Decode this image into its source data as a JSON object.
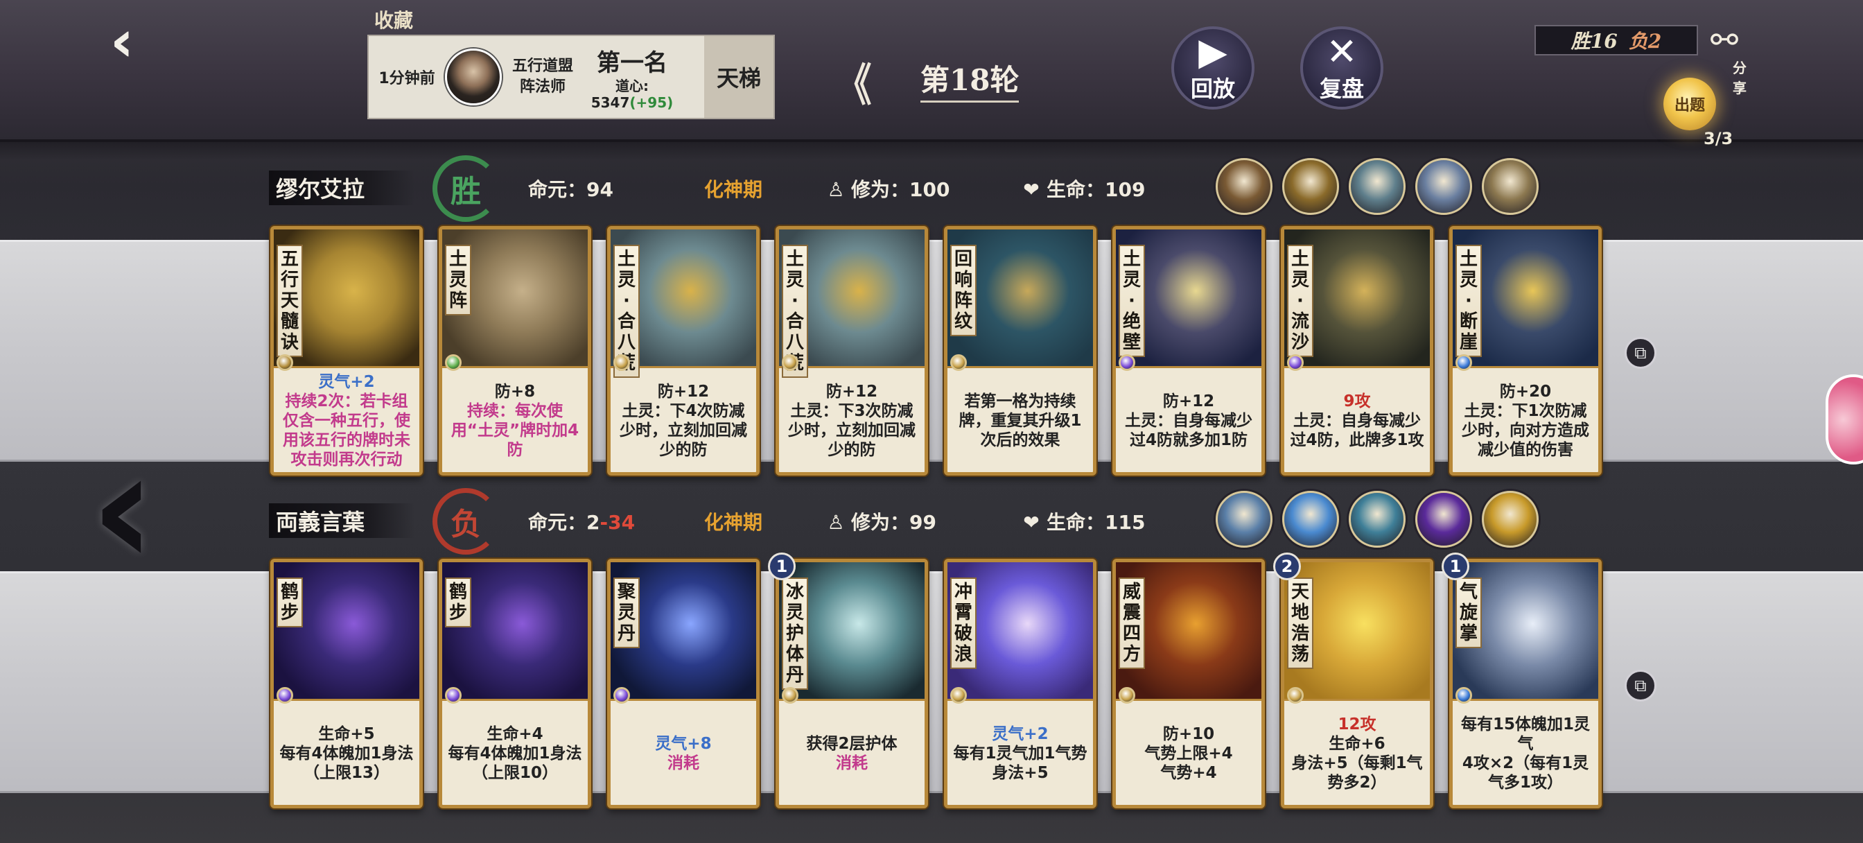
{
  "header": {
    "back_icon": "double-arrow-left-icon",
    "favorites_label": "收藏",
    "record": {
      "time": "1分钟前",
      "school_line1": "五行道盟",
      "school_line2": "阵法师",
      "rank": "第一名",
      "daoxin_label": "道心:",
      "daoxin_value": "5347",
      "daoxin_delta": "(+95)",
      "mode": "天梯"
    },
    "round": "第18轮",
    "play_label": "回放",
    "review_label": "复盘",
    "wins": "胜16",
    "losses": "负2",
    "share_label": "分享",
    "quiz_label": "出题",
    "quiz_count": "3/3"
  },
  "players": [
    {
      "name": "缪尔艾拉",
      "result": "胜",
      "life_essence_label": "命元：",
      "life_essence": "94",
      "life_essence_delta": "",
      "realm": "化神期",
      "cultivation_label": "修为：",
      "cultivation": "100",
      "hp_label": "生命：",
      "hp": "109",
      "badge_colors": [
        "#7a5a34",
        "#8a6a2a",
        "#5f7f8c",
        "#6a7fa0",
        "#8c7850"
      ],
      "cards": [
        {
          "name": "五行天髓诀",
          "text": [
            "灵气+2",
            "持续2次：若卡组仅含一种五行，使用该五行的牌时未攻击则再次行动"
          ],
          "art": [
            "#3a2b12",
            "#d8b34a",
            "#a78532"
          ],
          "gem": "#b38d3a",
          "level": ""
        },
        {
          "name": "土灵阵",
          "text": [
            "防+8",
            "持续：每次使用“土灵”牌时加4防"
          ],
          "art": [
            "#4c3f2a",
            "#c5b08a",
            "#8f7b58"
          ],
          "gem": "#5fae4a",
          "level": ""
        },
        {
          "name": "土灵·合八荒",
          "text": [
            "防+12",
            "土灵：下4次防减少时，立刻加回减少的防"
          ],
          "art": [
            "#3b4a50",
            "#d9b24a",
            "#6d8a90"
          ],
          "gem": "#c8a24a",
          "level": ""
        },
        {
          "name": "土灵·合八荒",
          "text": [
            "防+12",
            "土灵：下3次防减少时，立刻加回减少的防"
          ],
          "art": [
            "#3b4a50",
            "#d9b24a",
            "#6d8a90"
          ],
          "gem": "#c8a24a",
          "level": ""
        },
        {
          "name": "回响阵纹",
          "text": [
            "若第一格为持续牌，重复其升级1次后的效果"
          ],
          "art": [
            "#1f3a48",
            "#c7a85a",
            "#2d5565"
          ],
          "gem": "#c8a24a",
          "level": ""
        },
        {
          "name": "土灵·绝壁",
          "text": [
            "防+12",
            "土灵：自身每减少过4防就多加1防"
          ],
          "art": [
            "#1c2140",
            "#e8d890",
            "#4a4a6a"
          ],
          "gem": "#7a4ad8",
          "level": ""
        },
        {
          "name": "土灵·流沙",
          "text": [
            "9攻",
            "土灵：自身每减少过4防，此牌多1攻"
          ],
          "art": [
            "#23251e",
            "#d4b25a",
            "#55533a"
          ],
          "gem": "#7a4ad8",
          "level": ""
        },
        {
          "name": "土灵·断崖",
          "text": [
            "防+20",
            "土灵：下1次防减少时，向对方造成减少值的伤害"
          ],
          "art": [
            "#1b2a48",
            "#e8c658",
            "#3a4a6a"
          ],
          "gem": "#3a7ad8",
          "level": ""
        }
      ]
    },
    {
      "name": "両義言葉",
      "result": "负",
      "life_essence_label": "命元：",
      "life_essence": "2",
      "life_essence_delta": "-34",
      "realm": "化神期",
      "cultivation_label": "修为：",
      "cultivation": "99",
      "hp_label": "生命：",
      "hp": "115",
      "badge_colors": [
        "#5a7fa8",
        "#4a8ad0",
        "#3f7f98",
        "#5a2a9a",
        "#c89a2a"
      ],
      "cards": [
        {
          "name": "鹤步",
          "text": [
            "生命+5",
            "每有4体魄加1身法（上限13）"
          ],
          "art": [
            "#1b1240",
            "#8a5ad8",
            "#3a2a78"
          ],
          "gem": "#7a4ad8",
          "level": ""
        },
        {
          "name": "鹤步",
          "text": [
            "生命+4",
            "每有4体魄加1身法（上限10）"
          ],
          "art": [
            "#1b1240",
            "#8a5ad8",
            "#3a2a78"
          ],
          "gem": "#7a4ad8",
          "level": ""
        },
        {
          "name": "聚灵丹",
          "text": [
            "灵气+8",
            "消耗"
          ],
          "art": [
            "#101838",
            "#8aa6ff",
            "#2a3a88"
          ],
          "gem": "#7a4ad8",
          "level": ""
        },
        {
          "name": "冰灵护体丹",
          "text": [
            "获得2层护体",
            "消耗"
          ],
          "art": [
            "#1a2a30",
            "#c8e8e8",
            "#5a8a90"
          ],
          "gem": "#c8a24a",
          "level": "1"
        },
        {
          "name": "冲霄破浪",
          "text": [
            "灵气+2",
            "每有1灵气加1气势",
            "身法+5"
          ],
          "art": [
            "#3a2a78",
            "#e8d8f8",
            "#6a5ad8"
          ],
          "gem": "#c8a24a",
          "level": ""
        },
        {
          "name": "威震四方",
          "text": [
            "防+10",
            "气势上限+4",
            "气势+4"
          ],
          "art": [
            "#4a1a10",
            "#e8a030",
            "#8a3a18"
          ],
          "gem": "#c8a24a",
          "level": ""
        },
        {
          "name": "天地浩荡",
          "text": [
            "12攻",
            "生命+6",
            "身法+5（每剩1气势多2）"
          ],
          "art": [
            "#a87a20",
            "#f8e060",
            "#d8a838"
          ],
          "gem": "#c8a24a",
          "level": "2"
        },
        {
          "name": "气旋掌",
          "text": [
            "每有15体魄加1灵气",
            "4攻×2（每有1灵气多1攻）"
          ],
          "art": [
            "#2a3a58",
            "#e8eef8",
            "#7a8aa8"
          ],
          "gem": "#3a7ad8",
          "level": "1"
        }
      ]
    }
  ]
}
